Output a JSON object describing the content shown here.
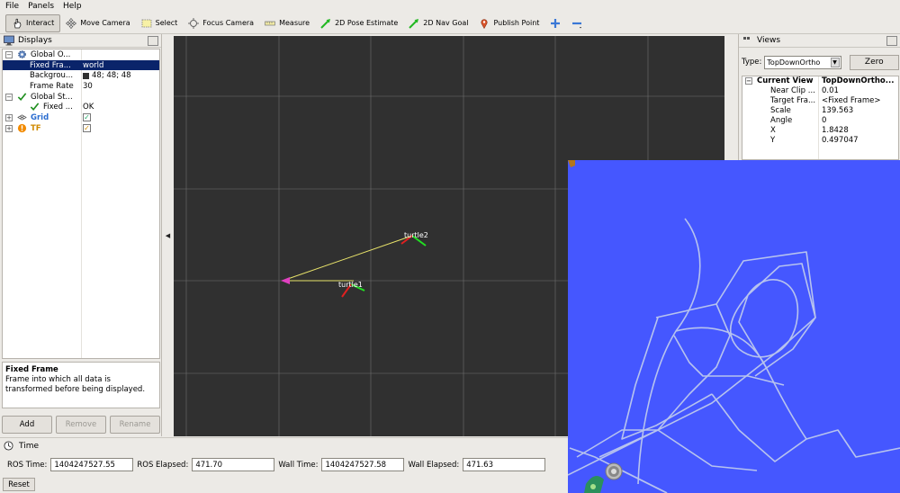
{
  "menu": [
    "File",
    "Panels",
    "Help"
  ],
  "toolbar": {
    "interact": "Interact",
    "move_camera": "Move Camera",
    "select": "Select",
    "focus_camera": "Focus Camera",
    "measure": "Measure",
    "pose_estimate": "2D Pose Estimate",
    "nav_goal": "2D Nav Goal",
    "publish_point": "Publish Point"
  },
  "displays": {
    "title": "Displays",
    "rows": [
      {
        "name": "Global O...",
        "value": ""
      },
      {
        "name": "Fixed Fra...",
        "value": "world"
      },
      {
        "name": "Backgrou...",
        "value": "48; 48; 48"
      },
      {
        "name": "Frame Rate",
        "value": "30"
      },
      {
        "name": "Global St...",
        "value": ""
      },
      {
        "name": "Fixed ...",
        "value": "OK"
      },
      {
        "name": "Grid",
        "value": ""
      },
      {
        "name": "TF",
        "value": ""
      }
    ],
    "description_title": "Fixed Frame",
    "description_text": "Frame into which all data is transformed before being displayed.",
    "buttons": {
      "add": "Add",
      "remove": "Remove",
      "rename": "Rename"
    }
  },
  "scene": {
    "frames": [
      "turtle2",
      "turtle1"
    ]
  },
  "views": {
    "title": "Views",
    "type_label": "Type:",
    "type_value": "TopDownOrtho",
    "zero": "Zero",
    "head_name": "Current View",
    "head_value": "TopDownOrtho...",
    "rows": [
      {
        "name": "Near Clip ...",
        "value": "0.01"
      },
      {
        "name": "Target Fra...",
        "value": "<Fixed Frame>"
      },
      {
        "name": "Scale",
        "value": "139.563"
      },
      {
        "name": "Angle",
        "value": "0"
      },
      {
        "name": "X",
        "value": "1.8428"
      },
      {
        "name": "Y",
        "value": "0.497047"
      }
    ]
  },
  "time": {
    "title": "Time",
    "ros_time_label": "ROS Time:",
    "ros_time": "1404247527.55",
    "ros_elapsed_label": "ROS Elapsed:",
    "ros_elapsed": "471.70",
    "wall_time_label": "Wall Time:",
    "wall_time": "1404247527.58",
    "wall_elapsed_label": "Wall Elapsed:",
    "wall_elapsed": "471.63",
    "reset": "Reset"
  },
  "colors": {
    "viewport_bg": "#303030",
    "turtlesim_bg": "#4557ff",
    "trail": "#b7c3ee",
    "selection": "#0a246a",
    "grid_label": "#2a6dd0",
    "tf_label": "#d08a00"
  }
}
